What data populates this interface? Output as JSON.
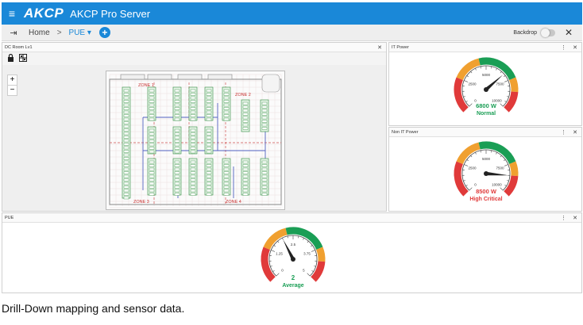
{
  "app": {
    "logo_text": "AKCP",
    "title": "AKCP Pro Server"
  },
  "toolbar": {
    "home_label": "Home",
    "crumb_separator": ">",
    "current_view": "PUE",
    "backdrop_label": "Backdrop",
    "close_glyph": "✕",
    "add_glyph": "+"
  },
  "panels": {
    "dc_room": {
      "title": "DC Room Lv1",
      "close_glyph": "✕",
      "zoom_in": "+",
      "zoom_out": "−",
      "zones": [
        "ZONE 1",
        "ZONE 2",
        "ZONE 3",
        "ZONE 4"
      ]
    },
    "it_power": {
      "title": "IT Power",
      "value_text": "6800 W",
      "status": "Normal",
      "value": 6800,
      "max": 10000,
      "ticks": [
        "0",
        "2500",
        "5000",
        "7500",
        "10000"
      ],
      "status_color": "#1a9e55"
    },
    "non_it_power": {
      "title": "Non IT Power",
      "value_text": "8500 W",
      "status": "High Critical",
      "value": 8500,
      "max": 10000,
      "ticks": [
        "0",
        "2500",
        "5000",
        "7500",
        "10000"
      ],
      "status_color": "#e03a3a"
    },
    "pue": {
      "title": "PUE",
      "value_text": "2",
      "status": "Average",
      "value": 2,
      "max": 5,
      "ticks": [
        "0",
        "1.25",
        "2.5",
        "3.75",
        "5"
      ],
      "status_color": "#1a9e55"
    },
    "menu_glyph": "⋮",
    "close_glyph": "✕"
  },
  "colors": {
    "appbar": "#1a88d8",
    "gauge_red": "#e03a3a",
    "gauge_orange": "#f0a030",
    "gauge_green": "#1a9e55"
  },
  "caption": "Drill-Down mapping and sensor data."
}
